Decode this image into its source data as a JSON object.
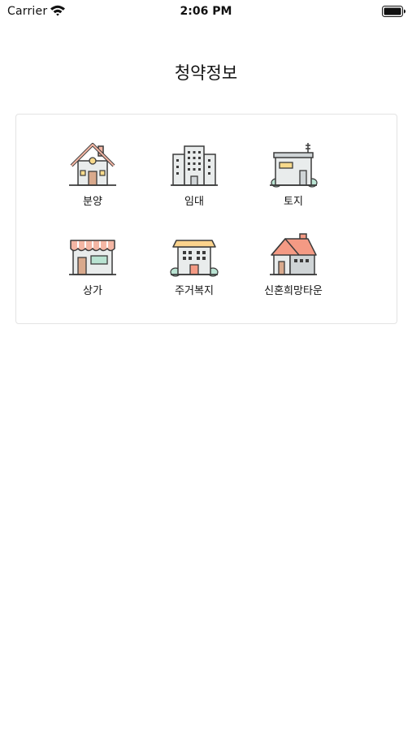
{
  "status_bar": {
    "carrier": "Carrier",
    "time": "2:06 PM",
    "wifi_icon": "wifi-icon",
    "battery_icon": "battery-icon"
  },
  "header": {
    "title": "청약정보"
  },
  "menu": {
    "items": [
      {
        "label": "분양",
        "icon": "house-icon"
      },
      {
        "label": "임대",
        "icon": "apartment-icon"
      },
      {
        "label": "토지",
        "icon": "land-icon"
      },
      {
        "label": "상가",
        "icon": "shop-icon"
      },
      {
        "label": "주거복지",
        "icon": "housing-welfare-icon"
      },
      {
        "label": "신혼희망타운",
        "icon": "newlywed-town-icon"
      }
    ]
  },
  "colors": {
    "outline": "#3b3b3b",
    "roof_pink": "#f4b6a4",
    "wall_light": "#e9ecec",
    "wall_gray": "#cfd4d6",
    "door": "#d9a98c",
    "window_gold": "#f7d98b",
    "mint": "#b9e3d2",
    "salmon": "#f49a84",
    "yellow": "#fbd38c"
  }
}
